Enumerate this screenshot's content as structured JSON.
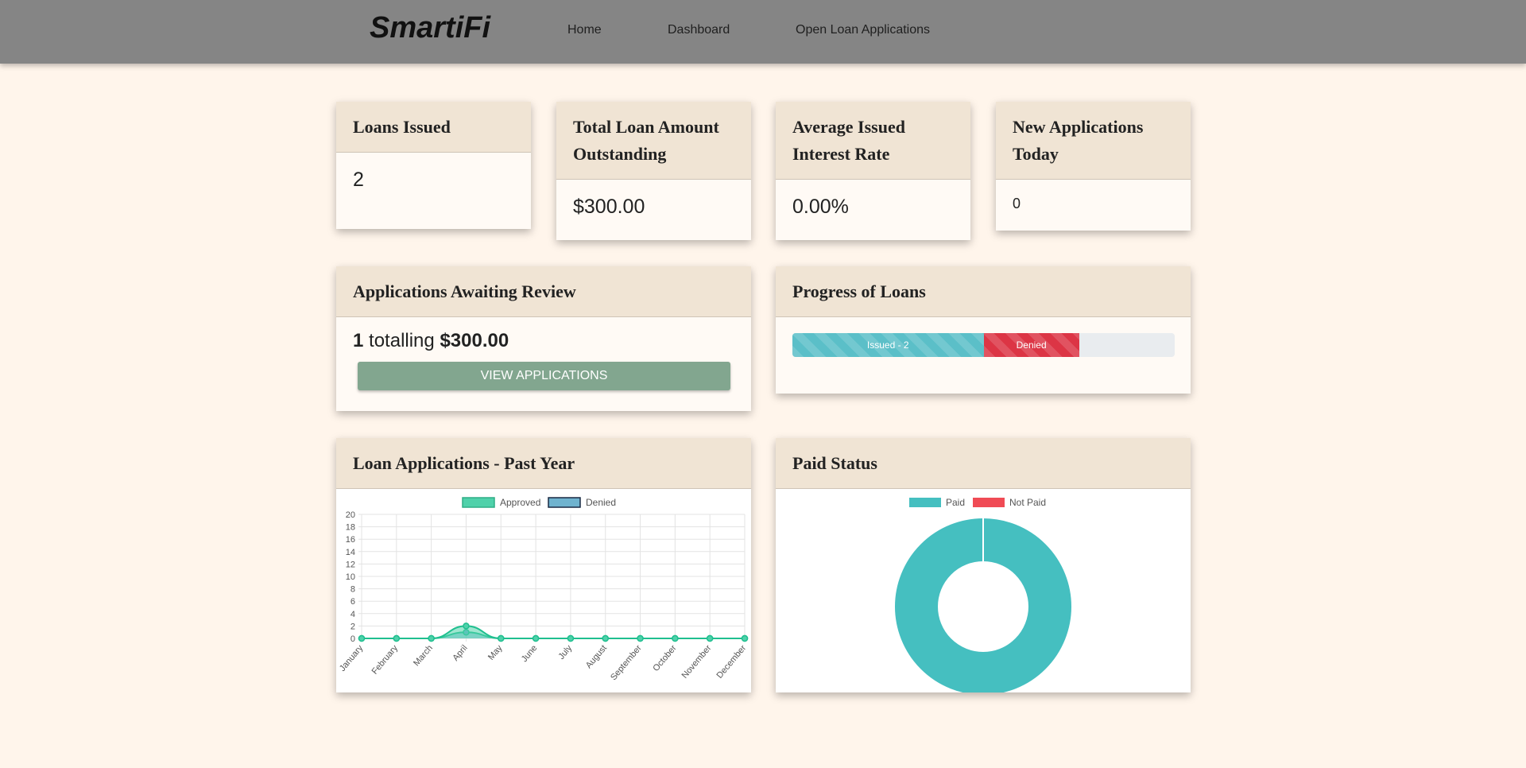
{
  "navbar": {
    "brand": "SmartiFi",
    "links": [
      "Home",
      "Dashboard",
      "Open Loan Applications"
    ]
  },
  "stats": [
    {
      "title": "Loans Issued",
      "value": "2"
    },
    {
      "title": "Total Loan Amount Outstanding",
      "value": "$300.00"
    },
    {
      "title": "Average Issued Interest Rate",
      "value": "0.00%"
    },
    {
      "title": "New Applications Today",
      "value": "0"
    }
  ],
  "awaiting": {
    "title": "Applications Awaiting Review",
    "count": "1",
    "middle_text": "totalling",
    "amount": "$300.00",
    "button_label": "VIEW APPLICATIONS"
  },
  "progress": {
    "title": "Progress of Loans",
    "issued_label": "Issued - 2",
    "denied_label": "Denied",
    "issued_fraction": 0.5,
    "denied_fraction": 0.25,
    "colors": {
      "issued": "#5bbfc8",
      "denied": "#dc3545",
      "track": "#e9ecef"
    }
  },
  "line_card": {
    "title": "Loan Applications - Past Year"
  },
  "pie_card": {
    "title": "Paid Status"
  },
  "chart_data": [
    {
      "type": "line",
      "categories": [
        "January",
        "February",
        "March",
        "April",
        "May",
        "June",
        "July",
        "August",
        "September",
        "October",
        "November",
        "December"
      ],
      "series": [
        {
          "name": "Approved",
          "values": [
            0,
            0,
            0,
            2,
            0,
            0,
            0,
            0,
            0,
            0,
            0,
            0
          ],
          "color": "#4fd1aa"
        },
        {
          "name": "Denied",
          "values": [
            0,
            0,
            0,
            1,
            0,
            0,
            0,
            0,
            0,
            0,
            0,
            0
          ],
          "color": "#6fb3cf"
        }
      ],
      "ylim": [
        0,
        20
      ],
      "yticks": [
        0,
        2,
        4,
        6,
        8,
        10,
        12,
        14,
        16,
        18,
        20
      ],
      "grid": true,
      "legend": "top-center",
      "xlabel": "",
      "ylabel": ""
    },
    {
      "type": "pie",
      "categories": [
        "Paid",
        "Not Paid"
      ],
      "values": [
        1,
        0
      ],
      "colors": [
        "#45bfc0",
        "#f04b55"
      ],
      "legend": "top-center"
    }
  ]
}
